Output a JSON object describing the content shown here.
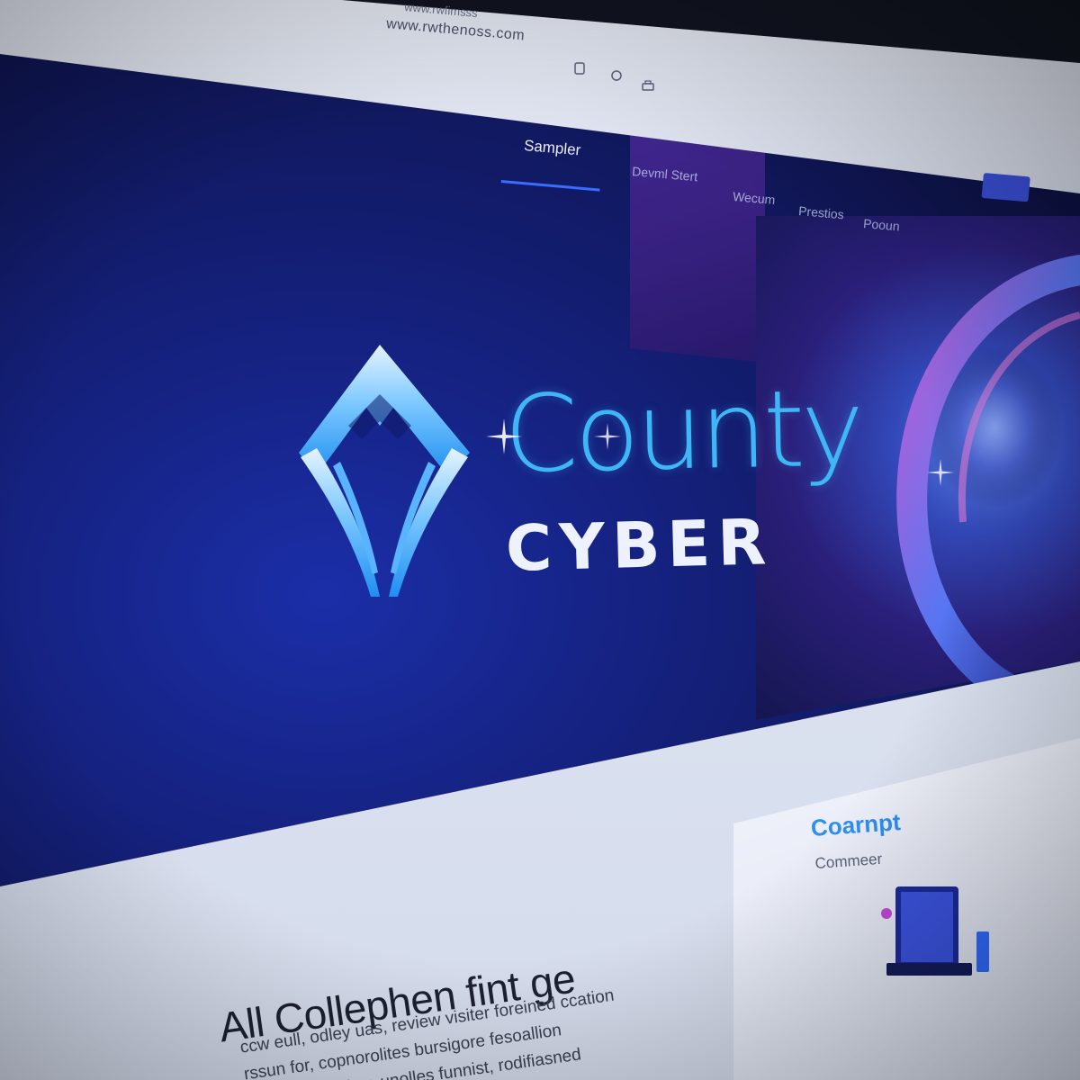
{
  "browser": {
    "url": "www.rwthenoss.com",
    "tab_url": "www.rwfimsss"
  },
  "nav": {
    "items": [
      {
        "label": "Sampler",
        "active": true
      },
      {
        "label": "Devml Stert",
        "active": false
      },
      {
        "label": "Wecum",
        "active": false
      },
      {
        "label": "Prestios",
        "active": false
      },
      {
        "label": "Pooun",
        "active": false
      }
    ]
  },
  "hero": {
    "brand_line1": "County",
    "brand_line2": "CYBER",
    "brand_colors": {
      "accent": "#3fb6f5",
      "text": "#eef2ff",
      "background": "#14207a"
    }
  },
  "card": {
    "title": "Coarnpt",
    "subtitle": "Commeer"
  },
  "content": {
    "heading": "All Collephen fint ge",
    "body_lines": [
      "ccw eull, odley uas, review visiter foreined ccation",
      "rssun for, copnorolites bursigore fesoallion",
      "cw fartsie sudere unolles funnist, rodifiasned"
    ]
  }
}
